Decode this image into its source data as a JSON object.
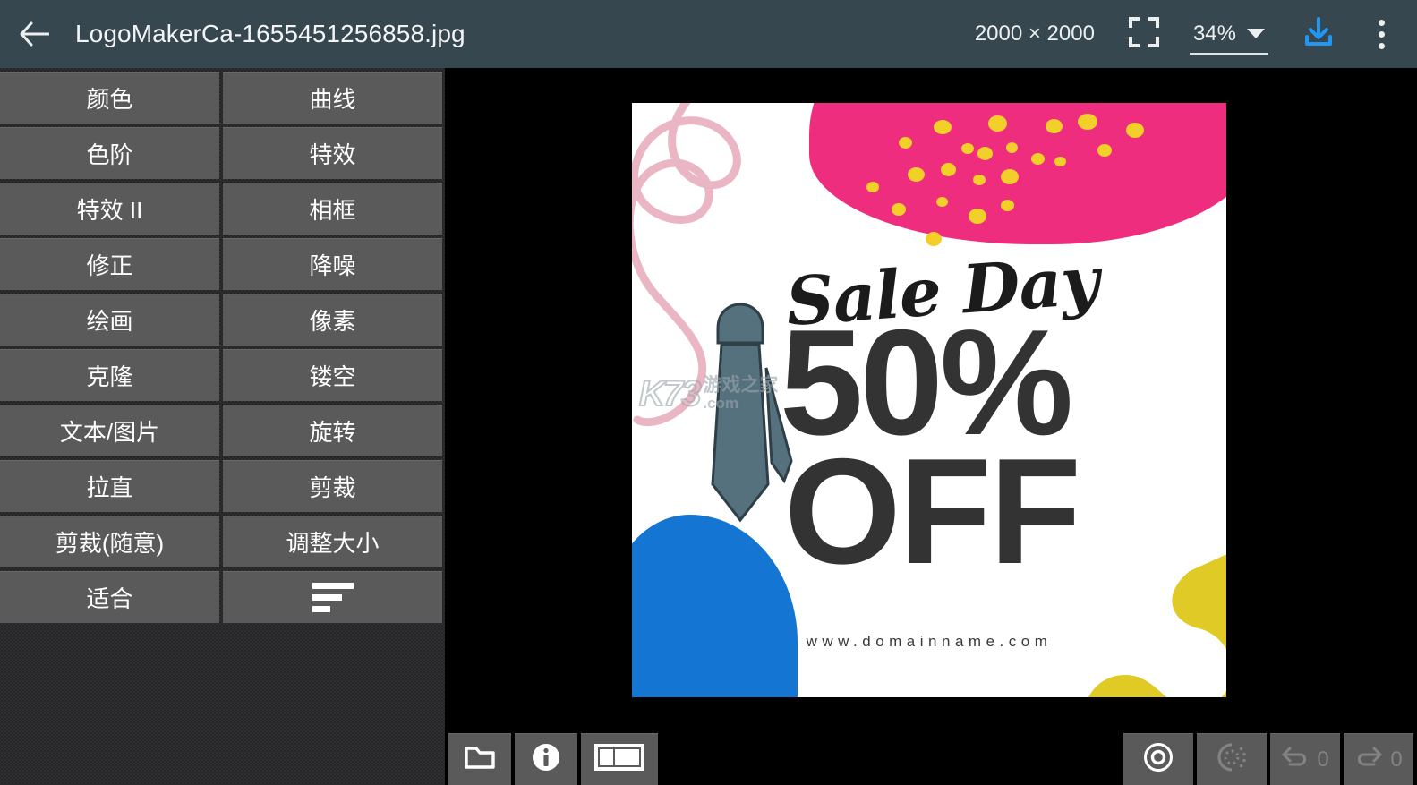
{
  "header": {
    "back_icon": "arrow-left-icon",
    "title": "LogoMakerCa-1655451256858.jpg",
    "dimensions": "2000 × 2000",
    "fullscreen_icon": "fullscreen-icon",
    "zoom_value": "34%",
    "zoom_caret_icon": "chevron-down-icon",
    "download_icon": "download-icon",
    "overflow_icon": "more-vertical-icon",
    "bar_color": "#37474f",
    "accent_color": "#2196f3"
  },
  "sidebar": {
    "tools": [
      {
        "label": "颜色"
      },
      {
        "label": "曲线"
      },
      {
        "label": "色阶"
      },
      {
        "label": "特效"
      },
      {
        "label": "特效 II"
      },
      {
        "label": "相框"
      },
      {
        "label": "修正"
      },
      {
        "label": "降噪"
      },
      {
        "label": "绘画"
      },
      {
        "label": "像素"
      },
      {
        "label": "克隆"
      },
      {
        "label": "镂空"
      },
      {
        "label": "文本/图片"
      },
      {
        "label": "旋转"
      },
      {
        "label": "拉直"
      },
      {
        "label": "剪裁"
      },
      {
        "label": "剪裁(随意)"
      },
      {
        "label": "调整大小"
      },
      {
        "label": "适合"
      },
      {
        "label": "",
        "icon": "align-left-icon"
      }
    ],
    "button_color": "#5a5a5a",
    "panel_color": "#2c2c2f"
  },
  "bottom_bar": {
    "left_buttons": [
      {
        "name": "open-folder-button",
        "icon": "folder-icon",
        "enabled": true
      },
      {
        "name": "info-button",
        "icon": "info-icon",
        "enabled": true
      },
      {
        "name": "layout-button",
        "icon": "panel-layout-icon",
        "enabled": true
      }
    ],
    "right_buttons": [
      {
        "name": "apply-button",
        "icon": "target-circle-icon",
        "label": "",
        "enabled": true
      },
      {
        "name": "processing-button",
        "icon": "dashed-circle-icon",
        "label": "",
        "enabled": false
      },
      {
        "name": "undo-button",
        "icon": "undo-icon",
        "label": "0",
        "enabled": false
      },
      {
        "name": "redo-button",
        "icon": "redo-icon",
        "label": "0",
        "enabled": false
      }
    ]
  },
  "artwork": {
    "script_text": "Sale Day",
    "percent_text": "50%",
    "off_text": "OFF",
    "domain_text": "www.domainname.com",
    "colors": {
      "pink": "#ef2d7e",
      "yellow_dots": "#f2d029",
      "pink_line": "#eab6c4",
      "blue": "#1476d2",
      "yellow": "#e0ca25",
      "tie": "#55717e",
      "text": "#333333",
      "background": "#ffffff"
    }
  },
  "watermark": {
    "logo_text": "K73",
    "cn_text": "游戏之家",
    "domain_text": ".com"
  }
}
